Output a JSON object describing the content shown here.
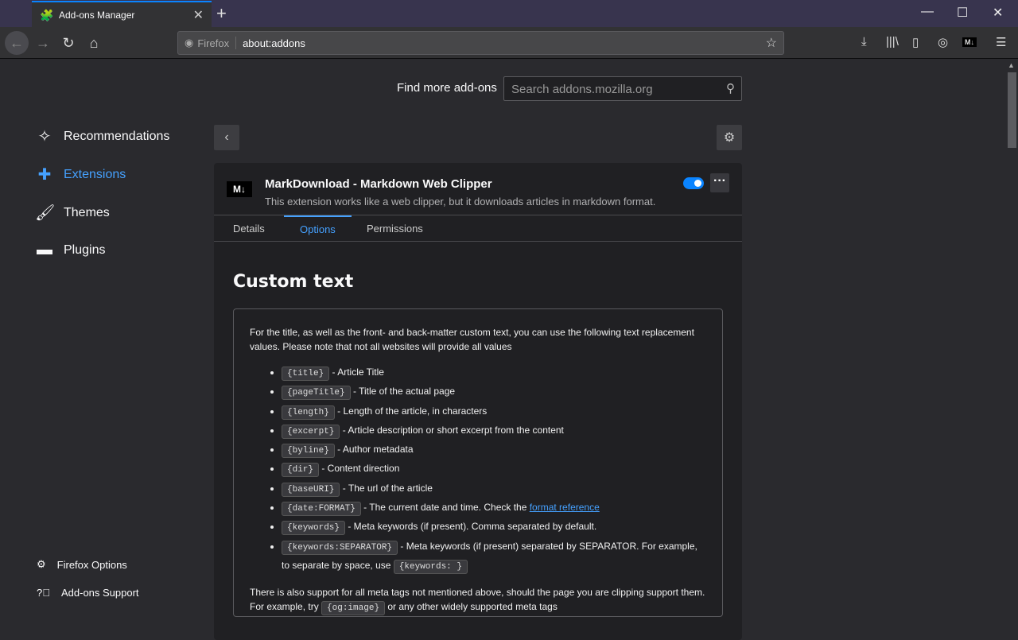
{
  "browser": {
    "tab_title": "Add-ons Manager",
    "identity": "Firefox",
    "url": "about:addons"
  },
  "header": {
    "find_label": "Find more add-ons",
    "search_placeholder": "Search addons.mozilla.org"
  },
  "sidebar": {
    "items": [
      {
        "label": "Recommendations"
      },
      {
        "label": "Extensions"
      },
      {
        "label": "Themes"
      },
      {
        "label": "Plugins"
      }
    ],
    "footer": [
      {
        "label": "Firefox Options"
      },
      {
        "label": "Add-ons Support"
      }
    ]
  },
  "addon": {
    "icon_text": "M↓",
    "name": "MarkDownload - Markdown Web Clipper",
    "description": "This extension works like a web clipper, but it downloads articles in markdown format.",
    "enabled": true,
    "tabs": [
      "Details",
      "Options",
      "Permissions"
    ],
    "selected_tab": "Options"
  },
  "options": {
    "heading": "Custom text",
    "intro": "For the title, as well as the front- and back-matter custom text, you can use the following text replacement values. Please note that not all websites will provide all values",
    "items": [
      {
        "code": "{title}",
        "text": " - Article Title"
      },
      {
        "code": "{pageTitle}",
        "text": " - Title of the actual page"
      },
      {
        "code": "{length}",
        "text": " - Length of the article, in characters"
      },
      {
        "code": "{excerpt}",
        "text": " - Article description or short excerpt from the content"
      },
      {
        "code": "{byline}",
        "text": " - Author metadata"
      },
      {
        "code": "{dir}",
        "text": " - Content direction"
      },
      {
        "code": "{baseURI}",
        "text": " - The url of the article"
      },
      {
        "code": "{date:FORMAT}",
        "text": " - The current date and time. Check the ",
        "link": "format reference"
      },
      {
        "code": "{keywords}",
        "text": " - Meta keywords (if present). Comma separated by default."
      },
      {
        "code": "{keywords:SEPARATOR}",
        "text": " - Meta keywords (if present) separated by SEPARATOR. For example, to separate by space, use ",
        "code2": "{keywords: }"
      }
    ],
    "outro_before": "There is also support for all meta tags not mentioned above, should the page you are clipping support them. For example, try ",
    "outro_code": "{og:image}",
    "outro_after": " or any other widely supported meta tags"
  }
}
